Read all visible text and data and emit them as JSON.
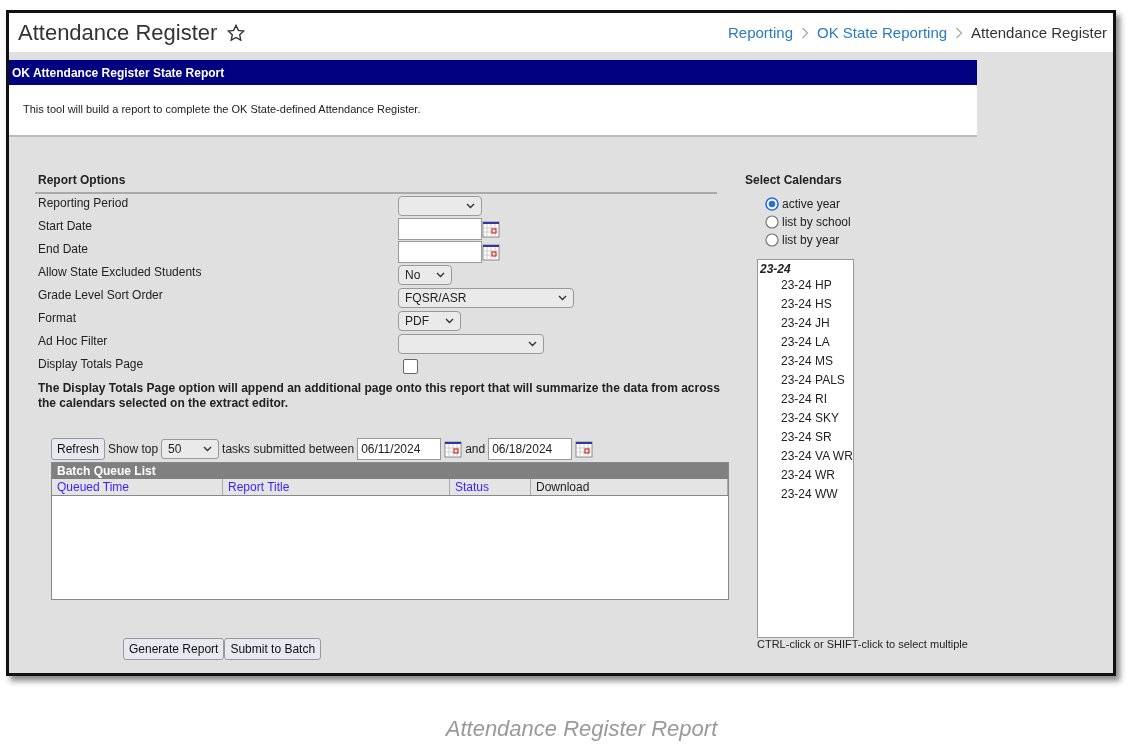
{
  "header": {
    "title": "Attendance Register",
    "favorite": false,
    "breadcrumbs": [
      {
        "label": "Reporting",
        "link": true
      },
      {
        "label": "OK State Reporting",
        "link": true
      },
      {
        "label": "Attendance Register",
        "link": false
      }
    ]
  },
  "panel": {
    "title": "OK Attendance Register State Report",
    "description": "This tool will build a report to complete the OK State-defined Attendance Register."
  },
  "report_options": {
    "heading": "Report Options",
    "fields": [
      {
        "kind": "select",
        "label": "Reporting Period"
      },
      {
        "kind": "date",
        "label": "Start Date"
      },
      {
        "kind": "date",
        "label": "End Date"
      },
      {
        "kind": "select",
        "label": "Allow State Excluded Students",
        "value": "No"
      },
      {
        "kind": "select",
        "label": "Grade Level Sort Order",
        "value": "FQSR/ASR"
      },
      {
        "kind": "select",
        "label": "Format",
        "value": "PDF"
      },
      {
        "kind": "select",
        "label": "Ad Hoc Filter"
      },
      {
        "kind": "checkbox",
        "label": "Display Totals Page",
        "checked": false
      }
    ],
    "note": "The Display Totals Page option will append an additional page onto this report that will summarize the data from across the calendars selected on the extract editor."
  },
  "batch": {
    "refresh": "Refresh",
    "show_top": "Show top",
    "count": "50",
    "between": "tasks submitted between",
    "from": "06/11/2024",
    "and": "and",
    "to": "06/18/2024",
    "title": "Batch Queue List",
    "columns": [
      {
        "label": "Queued Time",
        "sortable": true
      },
      {
        "label": "Report Title",
        "sortable": true
      },
      {
        "label": "Status",
        "sortable": true
      },
      {
        "label": "Download",
        "sortable": false
      }
    ]
  },
  "buttons": [
    "Generate Report",
    "Submit to Batch"
  ],
  "calendars": {
    "heading": "Select Calendars",
    "options": [
      {
        "label": "active year",
        "selected": true
      },
      {
        "label": "list by school",
        "selected": false
      },
      {
        "label": "list by year",
        "selected": false
      }
    ],
    "groups": [
      {
        "label": "23-24",
        "children": [
          {
            "label": "23-24 HP"
          },
          {
            "label": "23-24 HS"
          },
          {
            "label": "23-24 JH"
          },
          {
            "label": "23-24 LA"
          },
          {
            "label": "23-24 MS"
          },
          {
            "label": "23-24 PALS"
          },
          {
            "label": "23-24 RI"
          },
          {
            "label": "23-24 SKY"
          },
          {
            "label": "23-24 SR"
          },
          {
            "label": "23-24 VA WR"
          },
          {
            "label": "23-24 WR"
          },
          {
            "label": "23-24 WW"
          }
        ]
      }
    ],
    "hint": "CTRL-click or SHIFT-click to select multiple"
  },
  "caption": "Attendance Register Report"
}
